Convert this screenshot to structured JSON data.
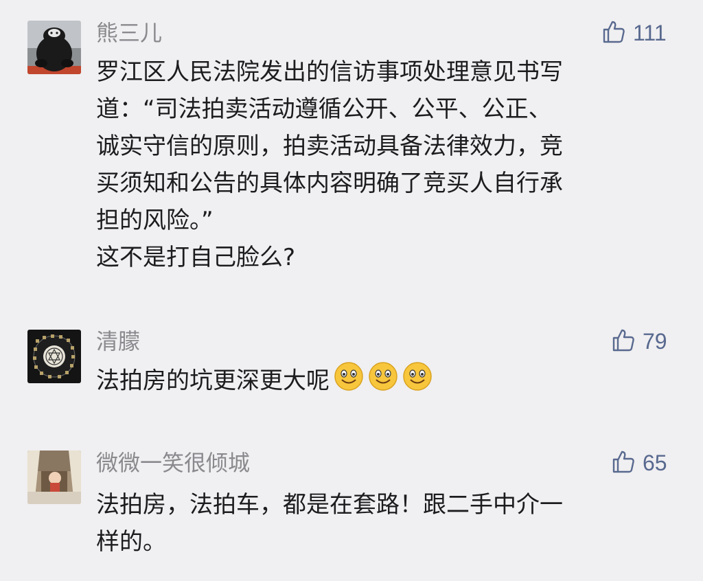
{
  "comments": [
    {
      "username": "熊三儿",
      "likes": "111",
      "lines": [
        "罗江区人民法院发出的信访事项处理意见书写",
        "道：“司法拍卖活动遵循公开、公平、公正、",
        "诚实守信的原则，拍卖活动具备法律效力，竞",
        "买须知和公告的具体内容明确了竞买人自行承",
        "担的风险。”",
        "这不是打自己脸么?"
      ]
    },
    {
      "username": "清朦",
      "likes": "79",
      "text": "法拍房的坑更深更大呢",
      "emoji": [
        "smile-emoji",
        "smile-emoji",
        "smile-emoji"
      ]
    },
    {
      "username": "微微一笑很倾城",
      "likes": "65",
      "lines": [
        "法拍房，法拍车，都是在套路！跟二手中介一",
        "样的。"
      ]
    }
  ],
  "icons": {
    "like": "thumbs-up-icon"
  },
  "colors": {
    "background": "#f0eff1",
    "username": "#8a8a8e",
    "like": "#58698f",
    "text": "#1c1c1e"
  }
}
